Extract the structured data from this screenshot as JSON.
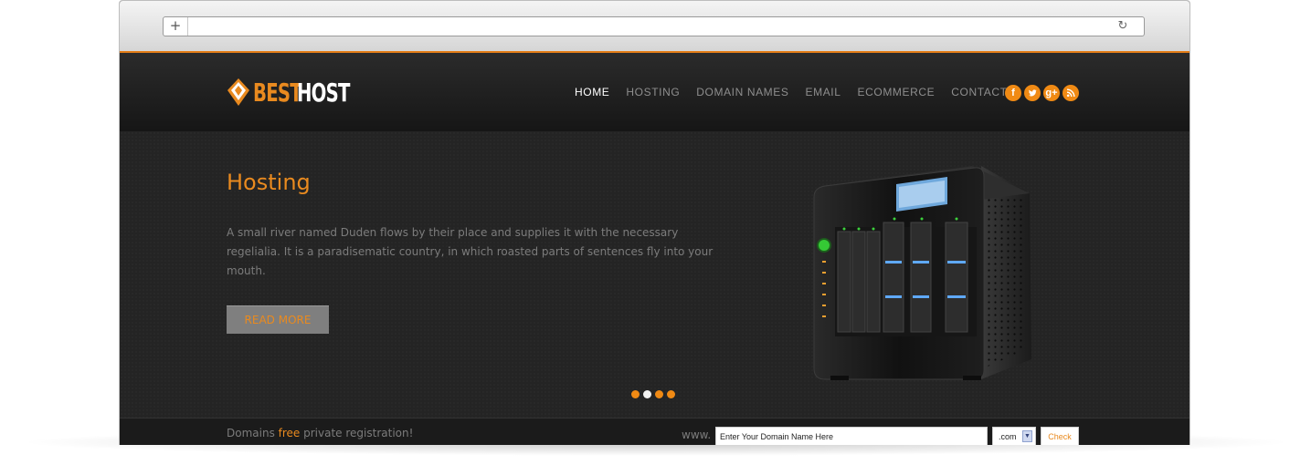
{
  "browser": {
    "new_tab_icon": "plus-icon",
    "reload_icon": "reload-icon"
  },
  "site": {
    "logo": {
      "best": "BEST",
      "host": "HOST"
    },
    "nav": [
      {
        "label": "HOME",
        "active": true
      },
      {
        "label": "HOSTING",
        "active": false
      },
      {
        "label": "DOMAIN NAMES",
        "active": false
      },
      {
        "label": "EMAIL",
        "active": false
      },
      {
        "label": "ECOMMERCE",
        "active": false
      },
      {
        "label": "CONTACT",
        "active": false
      }
    ],
    "social": [
      {
        "icon": "facebook-icon",
        "glyph": "f"
      },
      {
        "icon": "twitter-icon",
        "glyph": "t"
      },
      {
        "icon": "google-plus-icon",
        "glyph": "g+"
      },
      {
        "icon": "rss-icon",
        "glyph": "◉"
      }
    ]
  },
  "hero": {
    "title": "Hosting",
    "text": "A small river named Duden flows by their place and supplies it with the necessary regelialia. It is a paradisematic country, in which roasted parts of sentences fly into your mouth.",
    "button": "READ MORE",
    "image": "server-rack-image",
    "slides": 4,
    "active_slide": 2
  },
  "domain_bar": {
    "promo_prefix": "Domains ",
    "promo_highlight": "free",
    "promo_suffix": " private registration!",
    "www_label": "www.",
    "input_value": "Enter Your Domain Name Here",
    "tld": ".com",
    "check_label": "Check"
  },
  "colors": {
    "accent": "#e98a1f",
    "background": "#242424",
    "header": "#1a1a1a"
  }
}
